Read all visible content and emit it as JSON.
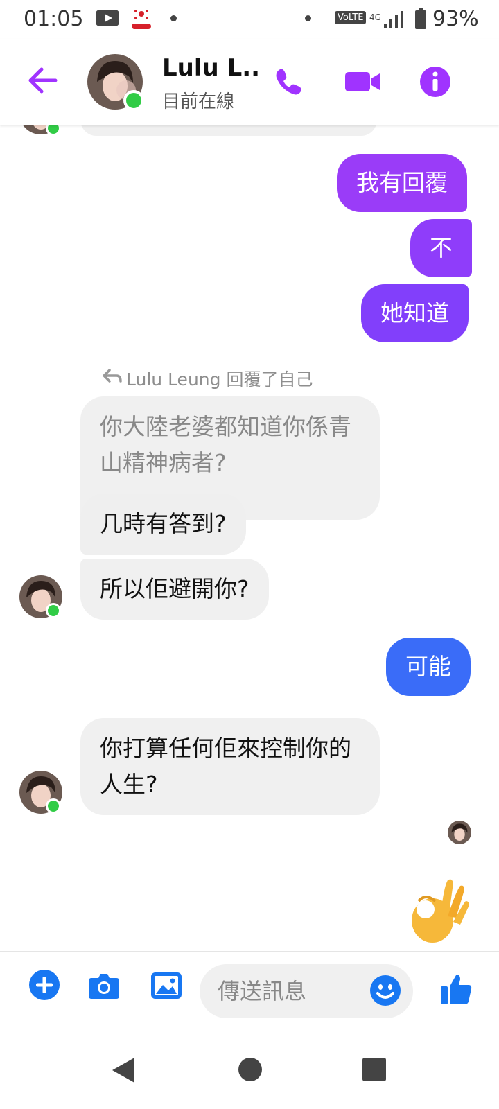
{
  "status_bar": {
    "time": "01:05",
    "volte": "VoLTE",
    "network": "4G",
    "battery": "93%"
  },
  "header": {
    "contact_name": "Lulu L...",
    "contact_status": "目前在線",
    "accent_color": "#a033ff"
  },
  "messages": {
    "out_1": "我有回覆",
    "out_2": "不",
    "out_3": "她知道",
    "reply_note": "Lulu Leung 回覆了自己",
    "in_quoted": "你大陸老婆都知道你係青山精神病者?",
    "in_1": "几時有答到?",
    "in_2": "所以佢避開你?",
    "out_4": "可能",
    "in_3": "你打算任何佢來控制你的人生?",
    "reaction_emoji": "ok-hand-icon"
  },
  "composer": {
    "placeholder": "傳送訊息"
  },
  "colors": {
    "outgoing_gradient_top": "#9d3cf7",
    "outgoing_purple": "#8a3dfa",
    "outgoing_blue": "#3a6cf8",
    "incoming_bg": "#f0f0f0",
    "composer_blue": "#1877f2",
    "online_green": "#31cc46"
  }
}
